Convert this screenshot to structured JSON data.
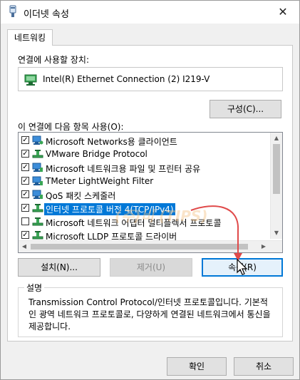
{
  "window": {
    "title": "이더넷 속성",
    "close_glyph": "✕"
  },
  "tabs": [
    {
      "label": "네트워킹"
    }
  ],
  "device": {
    "label": "연결에 사용할 장치:",
    "name": "Intel(R) Ethernet Connection (2) I219-V"
  },
  "configure_button": "구성(C)...",
  "items_label": "이 연결에 다음 항목 사용(O):",
  "items": [
    {
      "label": "Microsoft Networks용 클라이언트",
      "checked": true,
      "icon": "network-client-icon"
    },
    {
      "label": "VMware Bridge Protocol",
      "checked": true,
      "icon": "network-protocol-icon"
    },
    {
      "label": "Microsoft 네트워크용 파일 및 프린터 공유",
      "checked": true,
      "icon": "network-service-icon"
    },
    {
      "label": "TMeter LightWeight Filter",
      "checked": true,
      "icon": "network-service-icon"
    },
    {
      "label": "QoS 패킷 스케줄러",
      "checked": true,
      "icon": "network-service-icon"
    },
    {
      "label": "인터넷 프로토콜 버전 4(TCP/IPv4)",
      "checked": true,
      "icon": "network-protocol-icon",
      "selected": true
    },
    {
      "label": "Microsoft 네트워크 어댑터 멀티플렉서 프로토콜",
      "checked": false,
      "icon": "network-protocol-icon"
    },
    {
      "label": "Microsoft LLDP 프로토콜 드라이버",
      "checked": true,
      "icon": "network-protocol-icon"
    }
  ],
  "buttons": {
    "install": "설치(N)...",
    "uninstall": "제거(U)",
    "properties": "속성(R)"
  },
  "description": {
    "title": "설명",
    "text": "Transmission Control Protocol/인터넷 프로토콜입니다. 기본적인 광역 네트워크 프로토콜로, 다양하게 연결된 네트워크에서 통신을 제공합니다."
  },
  "watermark": "(주)비 (TIPS)",
  "footer": {
    "ok": "확인",
    "cancel": "취소"
  },
  "colors": {
    "selection": "#0078d7",
    "annotation_arrow": "#e04a4a"
  }
}
